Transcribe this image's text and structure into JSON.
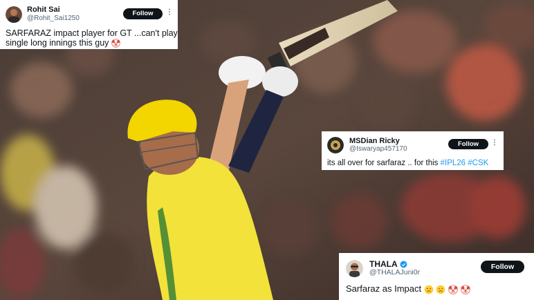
{
  "tweets": [
    {
      "name": "Rohit Sai",
      "handle": "@Rohit_Sai1250",
      "follow_label": "Follow",
      "more_label": "⋮",
      "text_line1": "SARFARAZ impact player for GT ...can't play a",
      "text_line2": "single long innings this guy",
      "emojis": [
        "clown-face"
      ]
    },
    {
      "name": "MSDian Ricky",
      "handle": "@Iswaryap457170",
      "follow_label": "Follow",
      "more_label": "⋮",
      "text_prefix": "its all over for sarfaraz .. for this ",
      "hashtag1": "#IPL26",
      "hashtag2": "#CSK"
    },
    {
      "name": "THALA",
      "handle": "@THALAJuni0r",
      "follow_label": "Follow",
      "text_line1": "Sarfaraz as Impact",
      "emojis": [
        "sad-face",
        "sad-face",
        "clown-face",
        "clown-face"
      ],
      "verified": true
    }
  ],
  "colors": {
    "hashtag": "#1d9bf0",
    "follow_bg": "#0f1419",
    "verified": "#1d9bf0",
    "jersey": "#f2e23a",
    "helmet": "#f3d500"
  }
}
